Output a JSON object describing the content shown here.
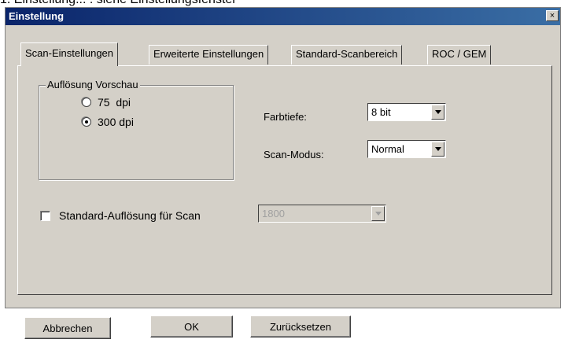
{
  "caption": "1. Einstellung... : siehe Einstellungsfenster",
  "window": {
    "title": "Einstellung",
    "close_glyph": "×"
  },
  "tabs": [
    {
      "label": "Scan-Einstellungen",
      "active": true
    },
    {
      "label": "Erweiterte Einstellungen",
      "active": false
    },
    {
      "label": "Standard-Scanbereich",
      "active": false
    },
    {
      "label": "ROC / GEM",
      "active": false
    }
  ],
  "preview_group": {
    "legend": "Auflösung Vorschau",
    "options": [
      {
        "label": "75  dpi",
        "selected": false
      },
      {
        "label": "300 dpi",
        "selected": true
      }
    ]
  },
  "color_depth": {
    "label": "Farbtiefe:",
    "value": "8 bit"
  },
  "scan_mode": {
    "label": "Scan-Modus:",
    "value": "Normal"
  },
  "default_resolution": {
    "label": "Standard-Auflösung für Scan",
    "checked": false,
    "value": "1800"
  },
  "buttons": {
    "cancel": "Abbrechen",
    "ok": "OK",
    "reset": "Zurücksetzen"
  }
}
